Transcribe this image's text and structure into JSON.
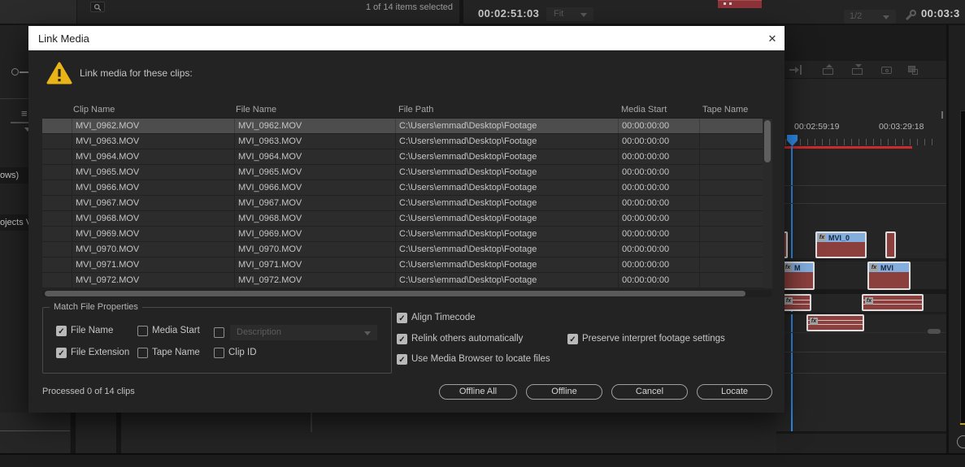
{
  "glyphs": {
    "check": "✓",
    "close": "✕",
    "fx": "fx",
    "menu": "≡"
  },
  "colors": {
    "playhead": "#2f8ceb",
    "render_bar": "#cc2b2b",
    "warning": "#e9b417",
    "clip_header": "#83aede",
    "clip_body": "#8c403e",
    "selected_row": "#4d4d4d",
    "dialog_titlebar": "#ffffff",
    "dialog_bg": "#232323"
  },
  "top_bar": {
    "items_selected": "1 of 14 items selected",
    "source_timecode": "00:02:51:03",
    "fit_label": "Fit",
    "zoom_level": "1/2",
    "program_timecode": "00:03:3"
  },
  "left_panel": {
    "row_1": "ows)",
    "row_2": "ojects V"
  },
  "timeline": {
    "ruler_start_tc": "00:02:59:19",
    "ruler_end_tc": "00:03:29:18",
    "clip_labels": {
      "v2": "MVI_0",
      "v1_left": "M",
      "v1_right": "MVI"
    }
  },
  "dialog": {
    "title": "Link Media",
    "message": "Link media for these clips:",
    "table": {
      "columns": [
        "Clip Name",
        "File Name",
        "File Path",
        "Media Start",
        "Tape Name"
      ],
      "rows": [
        {
          "clip_name": "MVI_0962.MOV",
          "file_name": "MVI_0962.MOV",
          "file_path": "C:\\Users\\emmad\\Desktop\\Footage",
          "media_start": "00:00:00:00",
          "tape_name": "",
          "selected": true
        },
        {
          "clip_name": "MVI_0963.MOV",
          "file_name": "MVI_0963.MOV",
          "file_path": "C:\\Users\\emmad\\Desktop\\Footage",
          "media_start": "00:00:00:00",
          "tape_name": "",
          "selected": false
        },
        {
          "clip_name": "MVI_0964.MOV",
          "file_name": "MVI_0964.MOV",
          "file_path": "C:\\Users\\emmad\\Desktop\\Footage",
          "media_start": "00:00:00:00",
          "tape_name": "",
          "selected": false
        },
        {
          "clip_name": "MVI_0965.MOV",
          "file_name": "MVI_0965.MOV",
          "file_path": "C:\\Users\\emmad\\Desktop\\Footage",
          "media_start": "00:00:00:00",
          "tape_name": "",
          "selected": false
        },
        {
          "clip_name": "MVI_0966.MOV",
          "file_name": "MVI_0966.MOV",
          "file_path": "C:\\Users\\emmad\\Desktop\\Footage",
          "media_start": "00:00:00:00",
          "tape_name": "",
          "selected": false
        },
        {
          "clip_name": "MVI_0967.MOV",
          "file_name": "MVI_0967.MOV",
          "file_path": "C:\\Users\\emmad\\Desktop\\Footage",
          "media_start": "00:00:00:00",
          "tape_name": "",
          "selected": false
        },
        {
          "clip_name": "MVI_0968.MOV",
          "file_name": "MVI_0968.MOV",
          "file_path": "C:\\Users\\emmad\\Desktop\\Footage",
          "media_start": "00:00:00:00",
          "tape_name": "",
          "selected": false
        },
        {
          "clip_name": "MVI_0969.MOV",
          "file_name": "MVI_0969.MOV",
          "file_path": "C:\\Users\\emmad\\Desktop\\Footage",
          "media_start": "00:00:00:00",
          "tape_name": "",
          "selected": false
        },
        {
          "clip_name": "MVI_0970.MOV",
          "file_name": "MVI_0970.MOV",
          "file_path": "C:\\Users\\emmad\\Desktop\\Footage",
          "media_start": "00:00:00:00",
          "tape_name": "",
          "selected": false
        },
        {
          "clip_name": "MVI_0971.MOV",
          "file_name": "MVI_0971.MOV",
          "file_path": "C:\\Users\\emmad\\Desktop\\Footage",
          "media_start": "00:00:00:00",
          "tape_name": "",
          "selected": false
        },
        {
          "clip_name": "MVI_0972.MOV",
          "file_name": "MVI_0972.MOV",
          "file_path": "C:\\Users\\emmad\\Desktop\\Footage",
          "media_start": "00:00:00:00",
          "tape_name": "",
          "selected": false
        }
      ]
    },
    "match_group": {
      "legend": "Match File Properties",
      "file_name": {
        "label": "File Name",
        "checked": true
      },
      "media_start": {
        "label": "Media Start",
        "checked": false
      },
      "description": {
        "label": "Description",
        "checked": false
      },
      "file_extension": {
        "label": "File Extension",
        "checked": true
      },
      "tape_name": {
        "label": "Tape Name",
        "checked": false
      },
      "clip_id": {
        "label": "Clip ID",
        "checked": false
      }
    },
    "options": {
      "align_timecode": {
        "label": "Align Timecode",
        "checked": true
      },
      "relink_others": {
        "label": "Relink others automatically",
        "checked": true
      },
      "preserve_interpret": {
        "label": "Preserve interpret footage settings",
        "checked": true
      },
      "use_media_browser": {
        "label": "Use Media Browser to locate files",
        "checked": true
      }
    },
    "status": "Processed 0 of 14 clips",
    "buttons": {
      "offline_all": "Offline All",
      "offline": "Offline",
      "cancel": "Cancel",
      "locate": "Locate"
    }
  }
}
